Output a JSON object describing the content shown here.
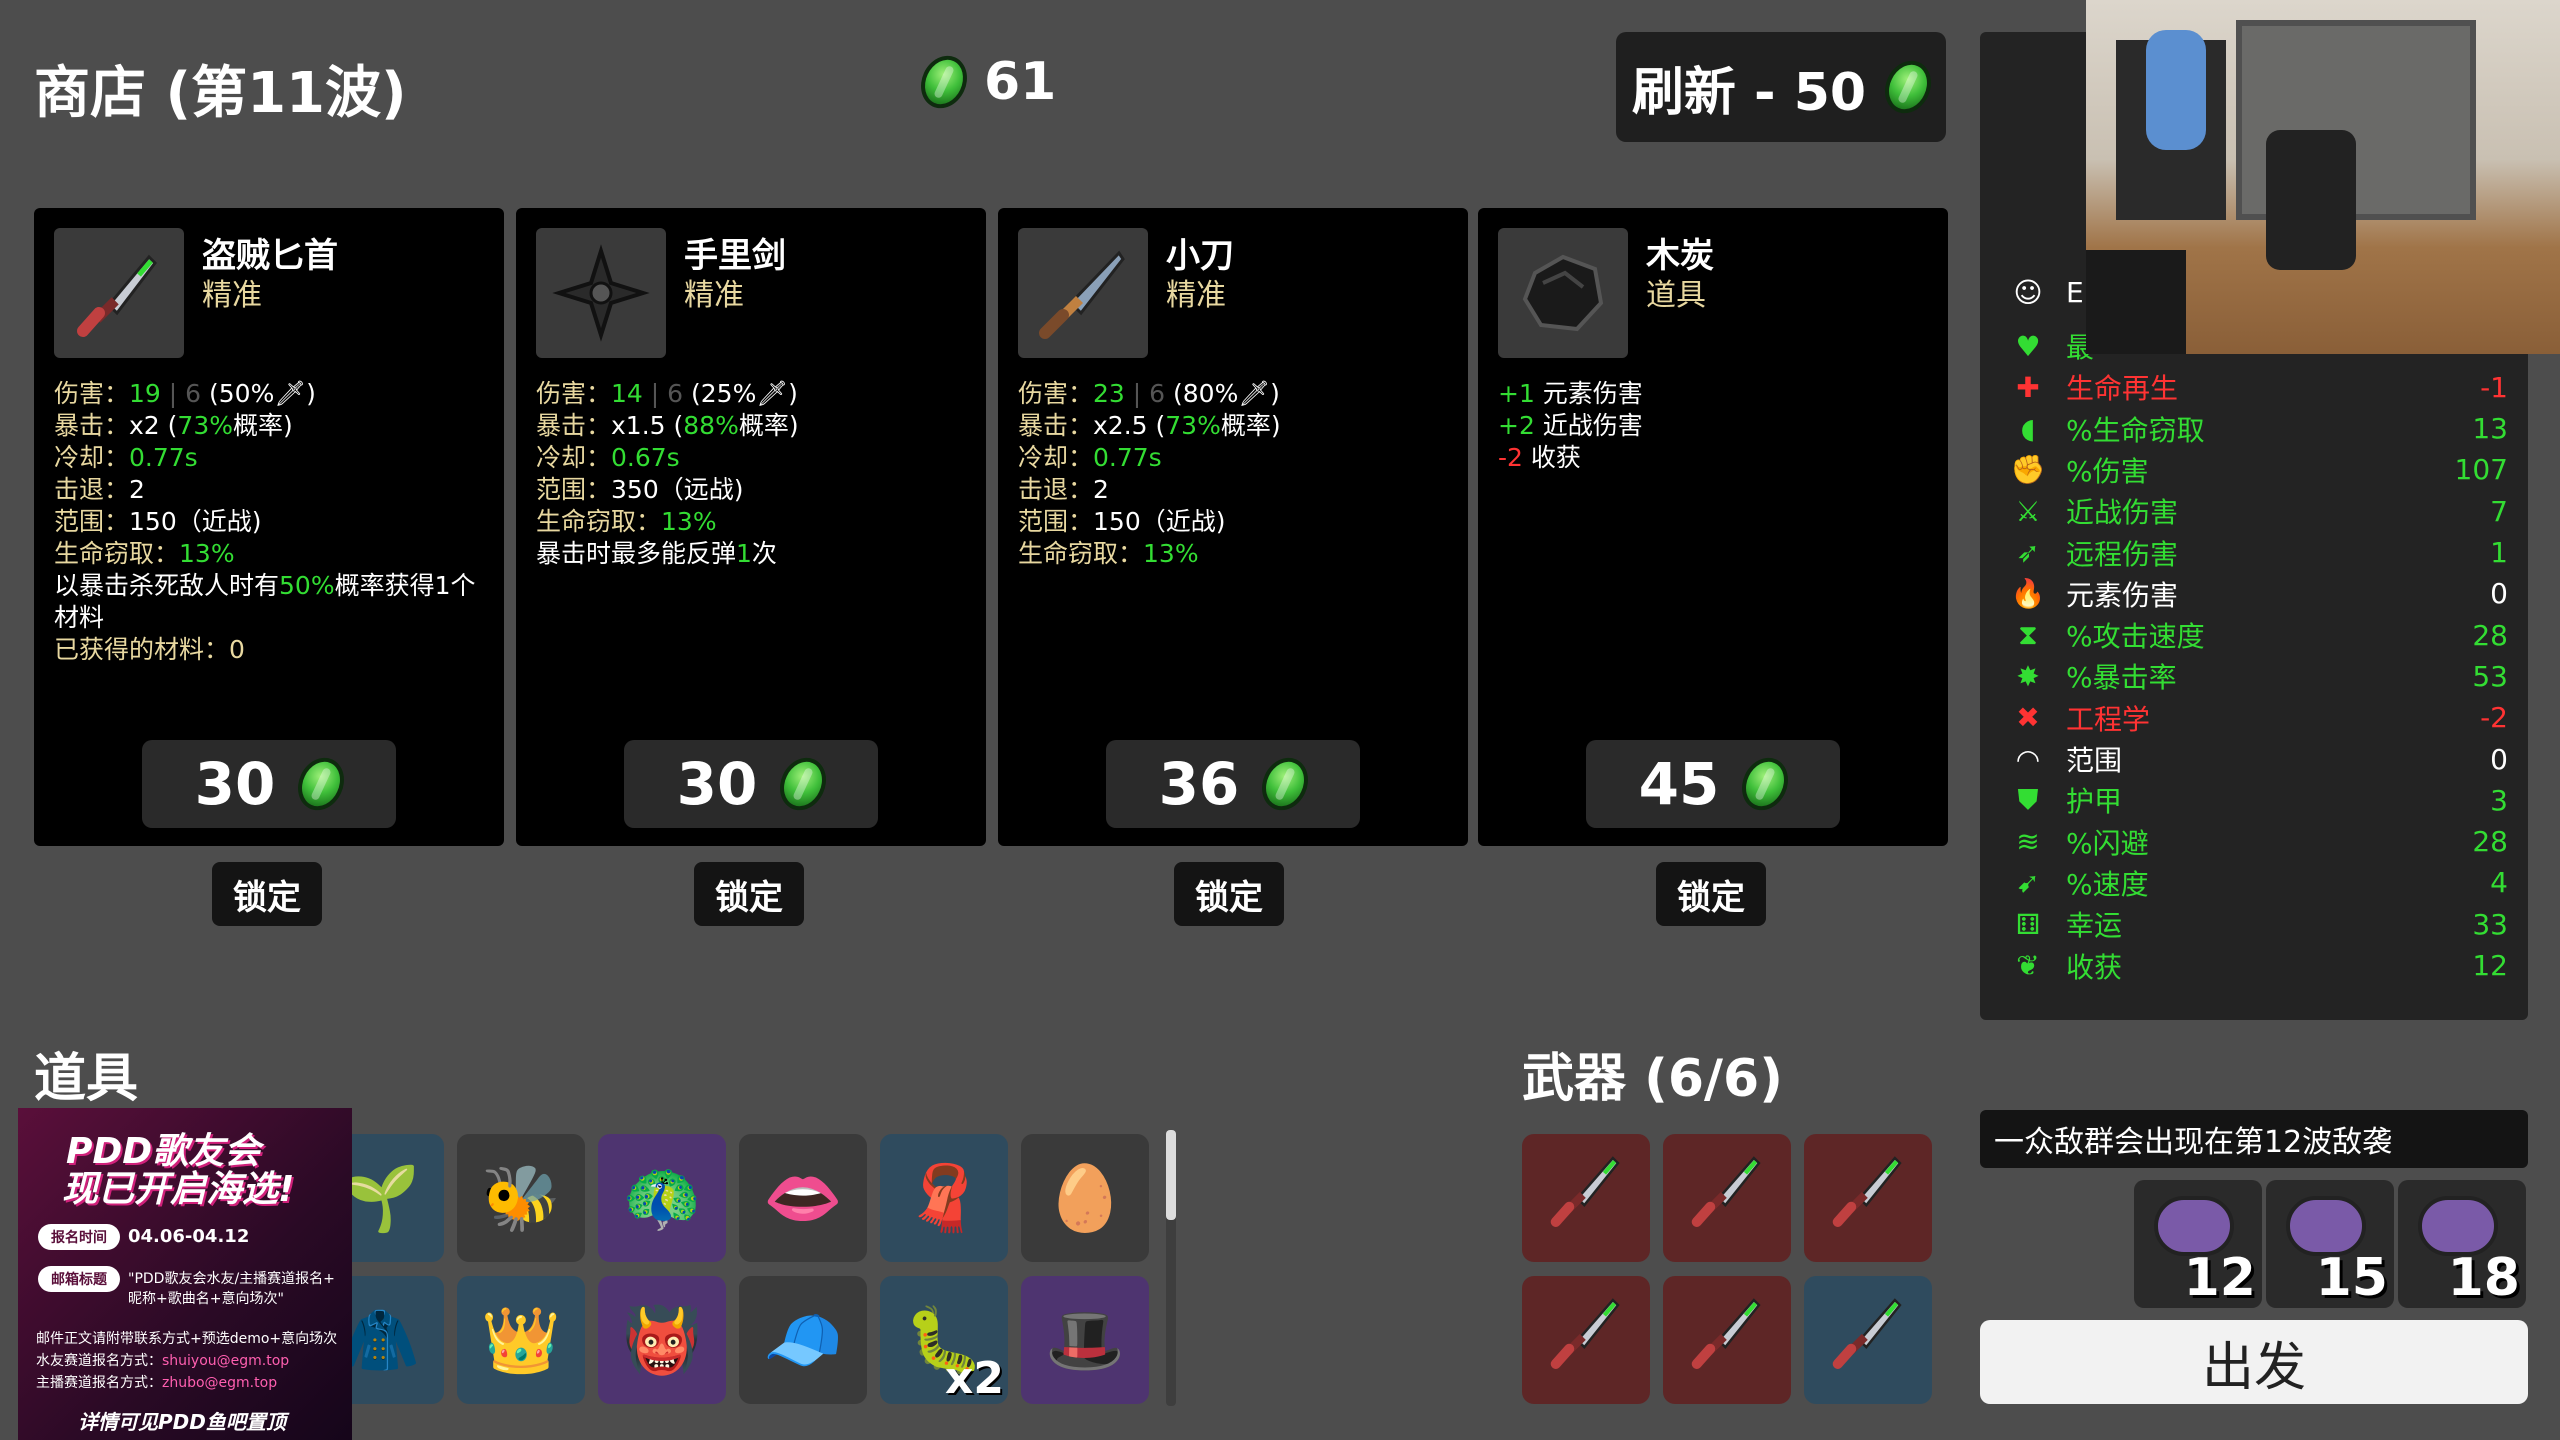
{
  "header": {
    "shop_title": "商店 (第11波)",
    "coins": "61",
    "refresh_label": "刷新 - 50"
  },
  "shop_cards": [
    {
      "name": "盗贼匕首",
      "sub": "精准",
      "stats": [
        {
          "label": "伤害：",
          "value": "19",
          "extra": "| 6",
          "tail": " (50%🗡)"
        },
        {
          "label": "暴击：",
          "value_white": "x2",
          "tail_open": " (",
          "value": "73%",
          "tail_close": "概率)"
        },
        {
          "label": "冷却：",
          "value": "0.77s"
        },
        {
          "label": "击退：",
          "value_white": "2"
        },
        {
          "label": "范围：",
          "value_white": "150（近战)"
        },
        {
          "label": "生命窃取：",
          "value": "13%"
        }
      ],
      "desc_parts": [
        "以暴击杀死敌人时有",
        "50%",
        "概率获得1个材料"
      ],
      "desc2": "已获得的材料：0",
      "price": "30",
      "lock": "锁定"
    },
    {
      "name": "手里剑",
      "sub": "精准",
      "stats": [
        {
          "label": "伤害：",
          "value": "14",
          "extra": "| 6",
          "tail": " (25%🗡)"
        },
        {
          "label": "暴击：",
          "value_white": "x1.5",
          "tail_open": " (",
          "value": "88%",
          "tail_close": "概率)"
        },
        {
          "label": "冷却：",
          "value": "0.67s"
        },
        {
          "label": "范围：",
          "value_white": "350（远战)"
        },
        {
          "label": "生命窃取：",
          "value": "13%"
        }
      ],
      "desc_parts": [
        "暴击时最多能反弹",
        "1",
        "次"
      ],
      "desc2": "",
      "price": "30",
      "lock": "锁定"
    },
    {
      "name": "小刀",
      "sub": "精准",
      "stats": [
        {
          "label": "伤害：",
          "value": "23",
          "extra": "| 6",
          "tail": " (80%🗡)"
        },
        {
          "label": "暴击：",
          "value_white": "x2.5",
          "tail_open": " (",
          "value": "73%",
          "tail_close": "概率)"
        },
        {
          "label": "冷却：",
          "value": "0.77s"
        },
        {
          "label": "击退：",
          "value_white": "2"
        },
        {
          "label": "范围：",
          "value_white": "150（近战)"
        },
        {
          "label": "生命窃取：",
          "value": "13%"
        }
      ],
      "desc_parts": [
        "",
        "",
        ""
      ],
      "desc2": "",
      "price": "36",
      "lock": "锁定"
    },
    {
      "name": "木炭",
      "sub": "道具",
      "effects": [
        {
          "value": "+1",
          "text": " 元素伤害",
          "color": "green"
        },
        {
          "value": "+2",
          "text": " 近战伤害",
          "color": "green"
        },
        {
          "value": "-2",
          "text": " 收获",
          "color": "red"
        }
      ],
      "price": "45",
      "lock": "锁定"
    }
  ],
  "stats_panel": {
    "header_initial": "E",
    "rows": [
      {
        "icon": "heart-icon",
        "glyph": "♥",
        "name": "最",
        "value": "",
        "color": "#33dd33"
      },
      {
        "icon": "regen-icon",
        "glyph": "✚",
        "name": "生命再生",
        "value": "-1",
        "color": "#ff3333"
      },
      {
        "icon": "lifesteal-icon",
        "glyph": "◖",
        "name": "%生命窃取",
        "value": "13",
        "color": "#33dd33"
      },
      {
        "icon": "damage-icon",
        "glyph": "✊",
        "name": "%伤害",
        "value": "107",
        "color": "#33dd33"
      },
      {
        "icon": "melee-icon",
        "glyph": "⚔",
        "name": "近战伤害",
        "value": "7",
        "color": "#33dd33"
      },
      {
        "icon": "ranged-icon",
        "glyph": "➶",
        "name": "远程伤害",
        "value": "1",
        "color": "#33dd33"
      },
      {
        "icon": "element-icon",
        "glyph": "🔥",
        "name": "元素伤害",
        "value": "0",
        "color": "#ffffff"
      },
      {
        "icon": "attack-speed-icon",
        "glyph": "⧗",
        "name": "%攻击速度",
        "value": "28",
        "color": "#33dd33"
      },
      {
        "icon": "crit-icon",
        "glyph": "✸",
        "name": "%暴击率",
        "value": "53",
        "color": "#33dd33"
      },
      {
        "icon": "engineering-icon",
        "glyph": "✖",
        "name": "工程学",
        "value": "-2",
        "color": "#ff3333"
      },
      {
        "icon": "range-icon",
        "glyph": "◠",
        "name": "范围",
        "value": "0",
        "color": "#ffffff"
      },
      {
        "icon": "armor-icon",
        "glyph": "⛊",
        "name": "护甲",
        "value": "3",
        "color": "#33dd33"
      },
      {
        "icon": "dodge-icon",
        "glyph": "≋",
        "name": "%闪避",
        "value": "28",
        "color": "#33dd33"
      },
      {
        "icon": "speed-icon",
        "glyph": "➹",
        "name": "%速度",
        "value": "4",
        "color": "#33dd33"
      },
      {
        "icon": "luck-icon",
        "glyph": "⚅",
        "name": "幸运",
        "value": "33",
        "color": "#33dd33"
      },
      {
        "icon": "harvest-icon",
        "glyph": "❦",
        "name": "收获",
        "value": "12",
        "color": "#33dd33"
      }
    ]
  },
  "items_section": {
    "title": "道具",
    "slots": [
      {
        "icon": "plant-pot-icon",
        "glyph": "🌱",
        "style": "blue",
        "badge": ""
      },
      {
        "icon": "bee-icon",
        "glyph": "🐝",
        "style": "gray",
        "badge": ""
      },
      {
        "icon": "peacock-icon",
        "glyph": "🦚",
        "style": "purple",
        "badge": ""
      },
      {
        "icon": "screaming-mouth-icon",
        "glyph": "👄",
        "style": "gray",
        "badge": ""
      },
      {
        "icon": "scarf-icon",
        "glyph": "🧣",
        "style": "blue",
        "badge": ""
      },
      {
        "icon": "ghost-egg-icon",
        "glyph": "🥚",
        "style": "gray",
        "badge": ""
      },
      {
        "icon": "red-cape-icon",
        "glyph": "🧥",
        "style": "blue",
        "badge": ""
      },
      {
        "icon": "crown-ring-icon",
        "glyph": "👑",
        "style": "blue",
        "badge": ""
      },
      {
        "icon": "horned-mask-icon",
        "glyph": "👹",
        "style": "purple",
        "badge": ""
      },
      {
        "icon": "beanie-icon",
        "glyph": "🧢",
        "style": "gray",
        "badge": ""
      },
      {
        "icon": "worm-icon",
        "glyph": "🐛",
        "style": "blue",
        "badge": "x2"
      },
      {
        "icon": "bowler-hat-icon",
        "glyph": "🎩",
        "style": "purple",
        "badge": ""
      }
    ]
  },
  "weapons_section": {
    "title": "武器 (6/6)",
    "slots": [
      {
        "icon": "dagger-icon",
        "style": "red"
      },
      {
        "icon": "dagger-icon",
        "style": "red"
      },
      {
        "icon": "dagger-icon",
        "style": "red"
      },
      {
        "icon": "dagger-icon",
        "style": "red"
      },
      {
        "icon": "dagger-icon",
        "style": "red"
      },
      {
        "icon": "dagger-icon",
        "style": "blue"
      }
    ]
  },
  "wave_info": {
    "text": "一众敌群会出现在第12波敌袭",
    "enemies": [
      {
        "icon": "bug-swarm-icon",
        "count": "12"
      },
      {
        "icon": "bug-swarm-icon",
        "count": "15"
      },
      {
        "icon": "horned-skull-icon",
        "count": "18"
      }
    ]
  },
  "go_button": "出发",
  "ad": {
    "title1": "PDD歌友会",
    "title2": "现已开启海选!",
    "tag1": "报名时间",
    "date": "04.06-04.12",
    "tag2": "邮箱标题",
    "mail_title": "\"PDD歌友会水友/主播赛道报名+",
    "mail_title2": "昵称+歌曲名+意向场次\"",
    "line1": "邮件正文请附带联系方式+预选demo+意向场次",
    "line2_label": "水友赛道报名方式：",
    "line2_value": "shuiyou@egm.top",
    "line3_label": "主播赛道报名方式：",
    "line3_value": "zhubo@egm.top",
    "bottom": "详情可见PDD鱼吧置顶"
  },
  "colors": {
    "background": "#4d4d4d",
    "card": "#000000",
    "green": "#33dd33",
    "red": "#ff3333",
    "label": "#e8d8a0",
    "weapon_slot": "#5e2626"
  }
}
